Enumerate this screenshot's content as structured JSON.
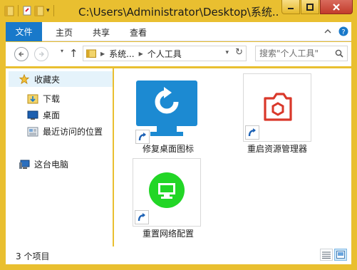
{
  "window": {
    "title": "C:\\Users\\Administrator\\Desktop\\系统...",
    "frame_color": "#e9bf30"
  },
  "ribbon": {
    "file_tab": "文件",
    "tabs": [
      "主页",
      "共享",
      "查看"
    ]
  },
  "address": {
    "breadcrumbs": [
      "系统...",
      "个人工具"
    ],
    "search_placeholder": "搜索\"个人工具\""
  },
  "navpane": {
    "favorites": "收藏夹",
    "downloads": "下载",
    "desktop": "桌面",
    "recent": "最近访问的位置",
    "this_pc": "这台电脑"
  },
  "items": [
    {
      "label": "修复桌面图标",
      "icon": "monitor-refresh-icon",
      "color": "#1c8ad2"
    },
    {
      "label": "重启资源管理器",
      "icon": "restart-explorer-icon",
      "color": "#d9382a"
    },
    {
      "label": "重置网络配置",
      "icon": "network-reset-icon",
      "color": "#22d626"
    }
  ],
  "status": {
    "item_count": "3 个项目"
  }
}
